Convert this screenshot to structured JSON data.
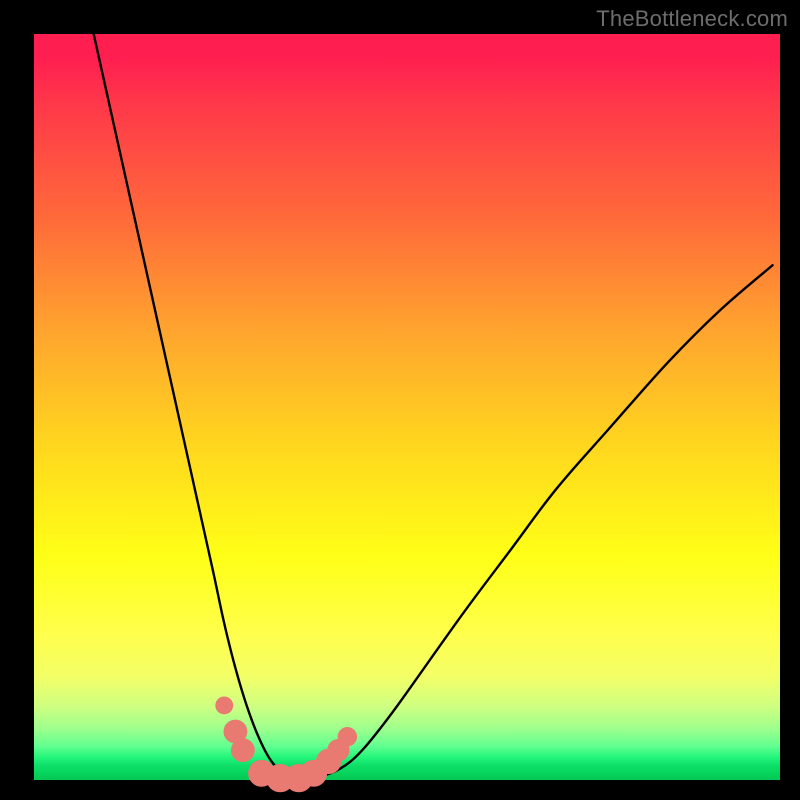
{
  "watermark": "TheBottleneck.com",
  "colors": {
    "frame": "#000000",
    "curve_stroke": "#000000",
    "marker_fill": "#e97a72",
    "gradient_top": "#ff1e50",
    "gradient_mid": "#ffff17",
    "gradient_bottom": "#05c855"
  },
  "chart_data": {
    "type": "line",
    "title": "",
    "xlabel": "",
    "ylabel": "",
    "xlim": [
      0,
      100
    ],
    "ylim": [
      0,
      100
    ],
    "annotations": [],
    "series": [
      {
        "name": "bottleneck-curve",
        "x": [
          8,
          10,
          12,
          14,
          16,
          18,
          20,
          22,
          24,
          25.5,
          27,
          28.5,
          30,
          31.5,
          33,
          34.5,
          36,
          38,
          41,
          44,
          48,
          53,
          58,
          64,
          70,
          77,
          85,
          92,
          99
        ],
        "y": [
          100,
          91,
          82,
          73,
          64,
          55,
          46,
          37,
          28,
          21,
          15,
          10,
          6,
          3,
          1.2,
          0.4,
          0.2,
          0.4,
          1.5,
          4,
          9,
          16,
          23,
          31,
          39,
          47,
          56,
          63,
          69
        ]
      }
    ],
    "markers": [
      {
        "x": 25.5,
        "y": 10.0,
        "r": 1.2
      },
      {
        "x": 27.0,
        "y": 6.5,
        "r": 1.6
      },
      {
        "x": 28.0,
        "y": 4.0,
        "r": 1.6
      },
      {
        "x": 30.5,
        "y": 0.9,
        "r": 1.8
      },
      {
        "x": 33.0,
        "y": 0.25,
        "r": 1.9
      },
      {
        "x": 35.5,
        "y": 0.25,
        "r": 1.9
      },
      {
        "x": 37.5,
        "y": 0.9,
        "r": 1.8
      },
      {
        "x": 39.5,
        "y": 2.5,
        "r": 1.7
      },
      {
        "x": 40.8,
        "y": 4.0,
        "r": 1.5
      },
      {
        "x": 42.0,
        "y": 5.8,
        "r": 1.3
      }
    ]
  }
}
